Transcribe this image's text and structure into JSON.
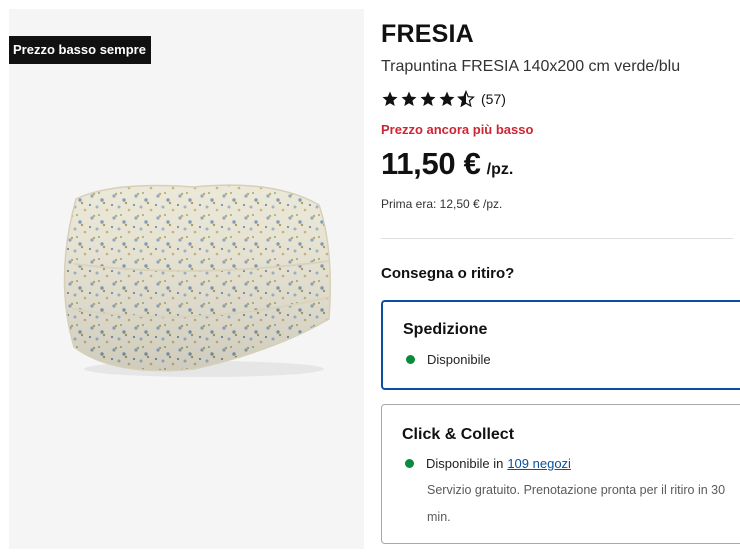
{
  "badge": {
    "label": "Prezzo basso sempre"
  },
  "product": {
    "brand": "FRESIA",
    "description": "Trapuntina FRESIA 140x200 cm verde/blu",
    "rating": {
      "stars": 4.5,
      "max": 5,
      "count": "(57)"
    },
    "price_label": "Prezzo ancora più basso",
    "price": "11,50 €",
    "price_unit": "/pz.",
    "previous_price": "Prima era: 12,50 € /pz."
  },
  "delivery": {
    "question": "Consegna o ritiro?",
    "shipping": {
      "title": "Spedizione",
      "status": "Disponibile"
    },
    "click_collect": {
      "title": "Click & Collect",
      "status": "Disponibile in",
      "stores_link": "109 negozi",
      "note_line1": "Servizio gratuito. Prenotazione pronta per il ritiro in 30",
      "note_line2": "min."
    }
  },
  "colors": {
    "accent_blue": "#0b4fa0",
    "price_red": "#cc2533",
    "available_green": "#0a8a3a"
  }
}
